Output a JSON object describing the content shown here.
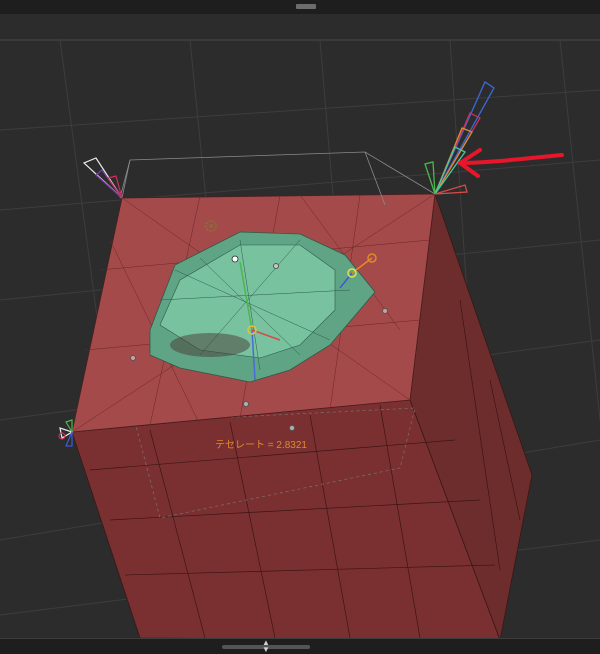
{
  "viewport": {
    "tessellation_label": "テセレート = 2.8321"
  },
  "colors": {
    "background": "#2c2c2c",
    "box_face": "#a54a4a",
    "box_side": "#6e2d2d",
    "mesh_cutout": "#5fa585",
    "annotation_arrow": "#e8162b",
    "label_text": "#e08a2a"
  },
  "icons": {
    "top_handle": "drag-handle-icon",
    "bottom_toggle": "collapse-expand-icon",
    "gear": "gear-icon"
  }
}
